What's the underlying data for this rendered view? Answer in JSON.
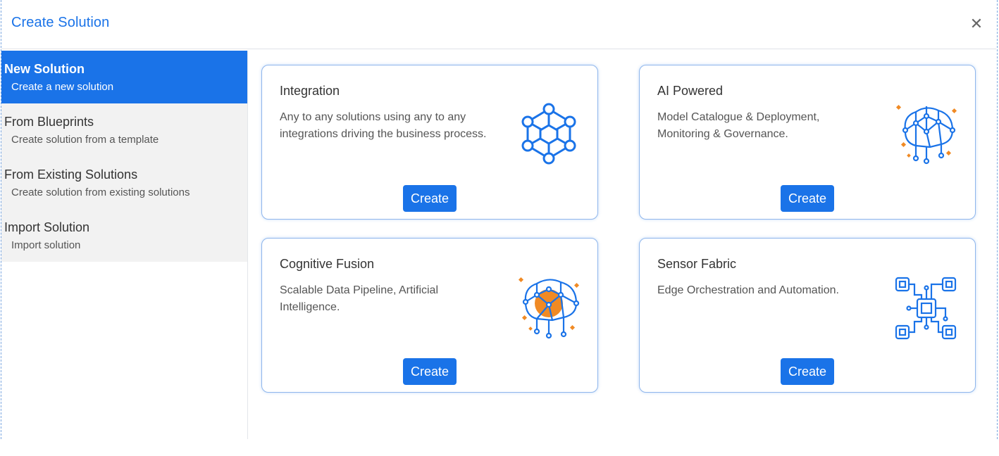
{
  "dialog": {
    "title": "Create Solution",
    "close_icon": "close-icon"
  },
  "sidebar": {
    "items": [
      {
        "title": "New Solution",
        "subtitle": "Create a new solution",
        "active": true
      },
      {
        "title": "From Blueprints",
        "subtitle": "Create solution from a template"
      },
      {
        "title": "From Existing Solutions",
        "subtitle": "Create solution from existing solutions"
      },
      {
        "title": "Import Solution",
        "subtitle": "Import solution"
      }
    ]
  },
  "cards": [
    {
      "title": "Integration",
      "description": "Any to any solutions using any to any integrations driving the business process.",
      "button": "Create",
      "icon": "hexagon-network-icon"
    },
    {
      "title": "AI Powered",
      "description": "Model Catalogue & Deployment, Monitoring & Governance.",
      "button": "Create",
      "icon": "brain-network-icon"
    },
    {
      "title": "Cognitive Fusion",
      "description": "Scalable Data Pipeline, Artificial Intelligence.",
      "button": "Create",
      "icon": "brain-fusion-icon"
    },
    {
      "title": "Sensor Fabric",
      "description": "Edge Orchestration and Automation.",
      "button": "Create",
      "icon": "circuit-chip-icon"
    }
  ],
  "colors": {
    "accent": "#1a73e8",
    "orange": "#f08a24",
    "sidebar_bg": "#f2f2f2"
  }
}
